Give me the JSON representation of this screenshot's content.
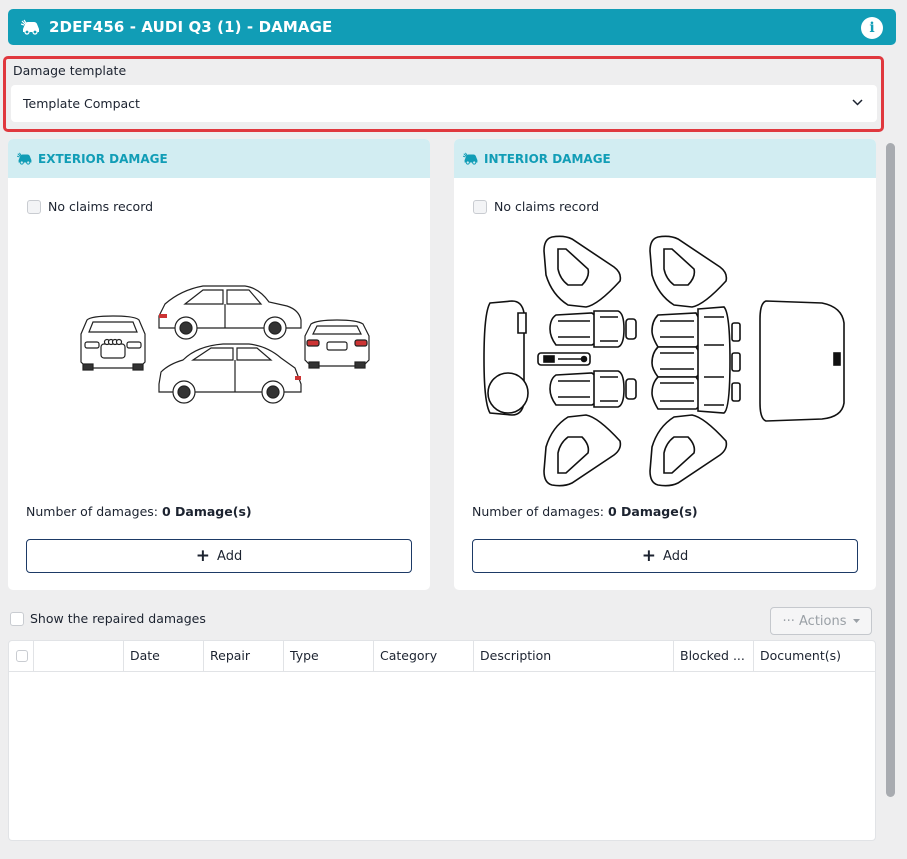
{
  "window": {
    "title": "2DEF456 - AUDI Q3 (1) - DAMAGE",
    "icon": "car-damage-icon",
    "info_icon": "info-icon",
    "info_glyph": "i",
    "accent_color": "#119db6"
  },
  "damage_template": {
    "label": "Damage template",
    "selected": "Template Compact"
  },
  "exterior": {
    "title": "EXTERIOR DAMAGE",
    "no_claims_label": "No claims record",
    "count_label": "Number of damages:",
    "count_value": "0 Damage(s)",
    "add_label": "Add"
  },
  "interior": {
    "title": "INTERIOR DAMAGE",
    "no_claims_label": "No claims record",
    "count_label": "Number of damages:",
    "count_value": "0 Damage(s)",
    "add_label": "Add"
  },
  "list": {
    "show_repaired_label": "Show the repaired damages",
    "actions_label": "··· Actions",
    "columns": [
      "",
      "Date",
      "Repair",
      "Type",
      "Category",
      "Description",
      "Blocked ...",
      "Document(s)"
    ],
    "rows": []
  }
}
